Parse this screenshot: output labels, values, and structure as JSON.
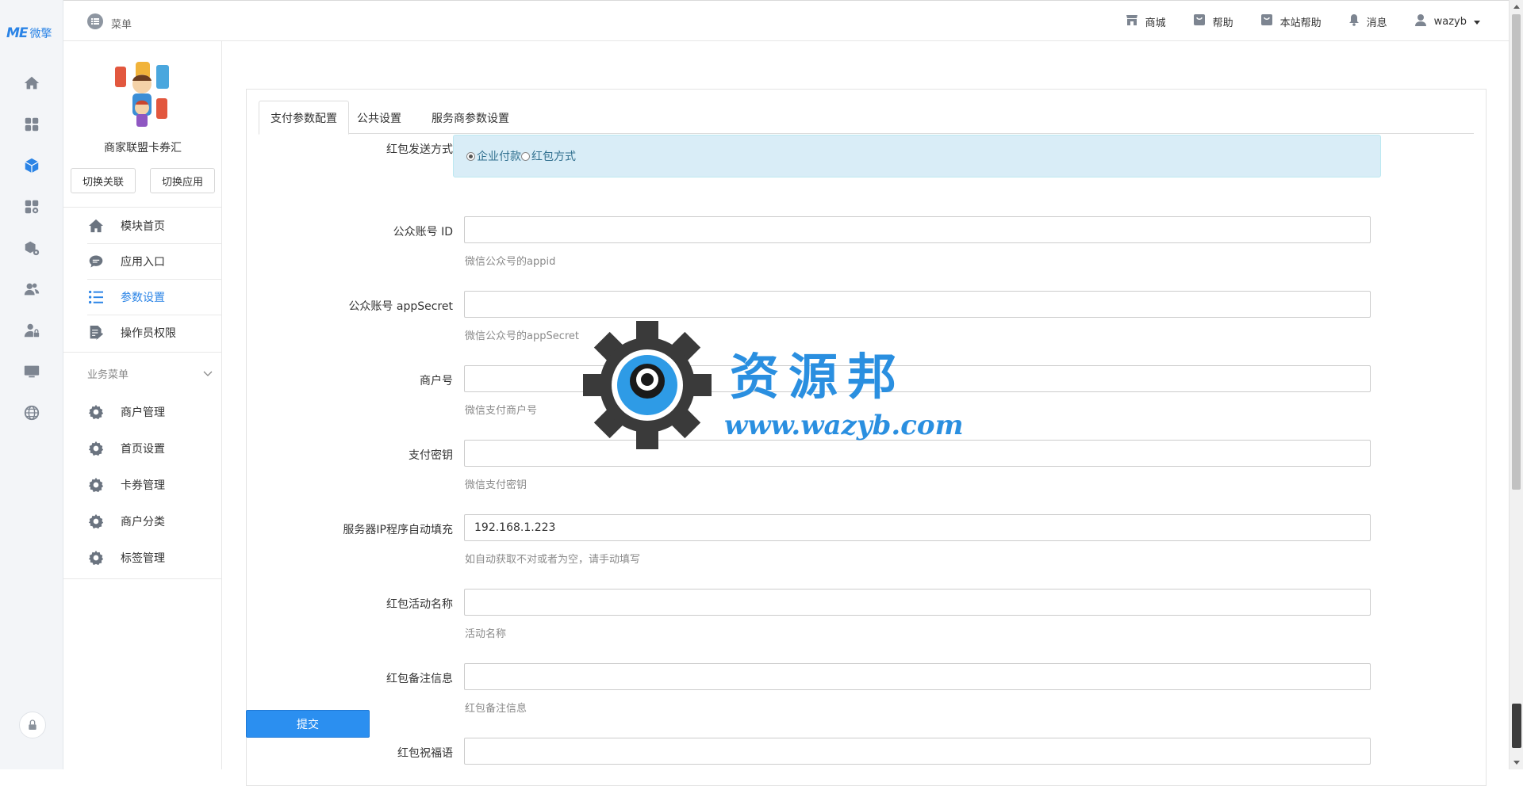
{
  "brand": {
    "logo_text": "ME",
    "logo_cn": "微擎"
  },
  "topbar": {
    "menu_label": "菜单",
    "links": [
      {
        "label": "商城",
        "icon": "store-icon"
      },
      {
        "label": "帮助",
        "icon": "help-bag-icon"
      },
      {
        "label": "本站帮助",
        "icon": "site-help-bag-icon"
      },
      {
        "label": "消息",
        "icon": "bell-icon"
      },
      {
        "label": "wazyb",
        "icon": "user-icon"
      }
    ]
  },
  "rail": {
    "items": [
      "home-icon",
      "apps-grid-icon",
      "module-cube-icon",
      "apps-settings-icon",
      "box-settings-icon",
      "users-icon",
      "user-lock-icon",
      "monitor-icon",
      "globe-icon"
    ],
    "active_index": 2
  },
  "sidebar": {
    "app_name": "商家联盟卡券汇",
    "switch_link": "切换关联",
    "switch_app": "切换应用",
    "items": [
      {
        "label": "模块首页",
        "icon": "home-icon"
      },
      {
        "label": "应用入口",
        "icon": "chat-icon"
      },
      {
        "label": "参数设置",
        "icon": "list-settings-icon",
        "active": true
      },
      {
        "label": "操作员权限",
        "icon": "document-edit-icon"
      }
    ],
    "section_title": "业务菜单",
    "business_items": [
      {
        "label": "商户管理"
      },
      {
        "label": "首页设置"
      },
      {
        "label": "卡券管理"
      },
      {
        "label": "商户分类"
      },
      {
        "label": "标签管理"
      }
    ]
  },
  "tabs": [
    "支付参数配置",
    "公共设置",
    "服务商参数设置"
  ],
  "form": {
    "redpack_mode_label": "红包发送方式",
    "redpack_mode_options": [
      "企业付款",
      "红包方式"
    ],
    "redpack_mode_selected": "企业付款",
    "fields": [
      {
        "label": "公众账号 ID",
        "value": "",
        "help": "微信公众号的appid"
      },
      {
        "label": "公众账号 appSecret",
        "value": "",
        "help": "微信公众号的appSecret"
      },
      {
        "label": "商户号",
        "value": "",
        "help": "微信支付商户号"
      },
      {
        "label": "支付密钥",
        "value": "",
        "help": "微信支付密钥"
      },
      {
        "label": "服务器IP程序自动填充",
        "value": "192.168.1.223",
        "help": "如自动获取不对或者为空，请手动填写"
      },
      {
        "label": "红包活动名称",
        "value": "",
        "help": "活动名称"
      },
      {
        "label": "红包备注信息",
        "value": "",
        "help": "红包备注信息"
      },
      {
        "label": "红包祝福语",
        "value": ""
      }
    ],
    "submit_label": "提交"
  },
  "watermark": {
    "title": "资源邦",
    "url": "www.wazyb.com"
  }
}
